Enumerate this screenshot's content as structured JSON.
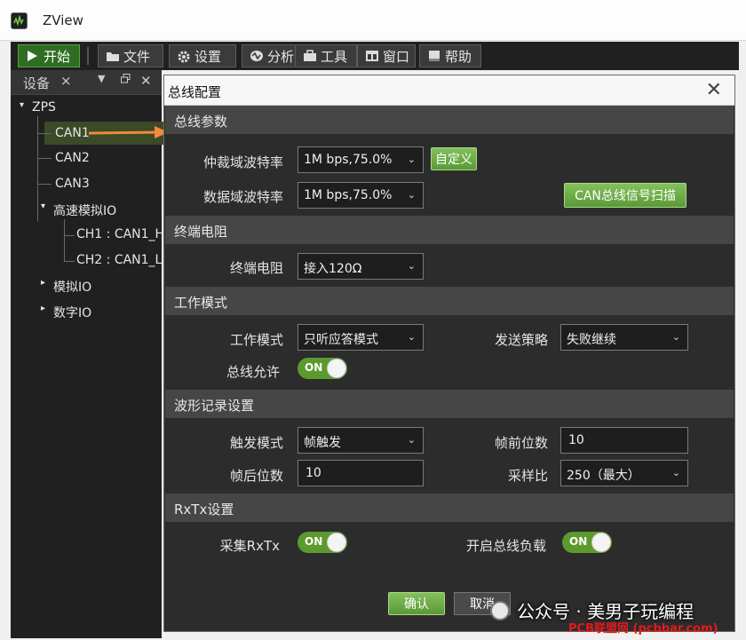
{
  "app": {
    "title": "ZView"
  },
  "menu": [
    {
      "label": "开始",
      "icon": "play-icon"
    },
    {
      "label": "文件",
      "icon": "folder-icon"
    },
    {
      "label": "设置",
      "icon": "gear-icon"
    },
    {
      "label": "分析",
      "icon": "analyze-icon"
    },
    {
      "label": "工具",
      "icon": "toolbox-icon"
    },
    {
      "label": "窗口",
      "icon": "window-icon"
    },
    {
      "label": "帮助",
      "icon": "help-icon"
    }
  ],
  "device_panel": {
    "title": "设备",
    "close": "×",
    "menu": "▼",
    "float": "🗗",
    "close2": "✕",
    "tree": {
      "root": "ZPS",
      "can1": "CAN1",
      "can2": "CAN2",
      "can3": "CAN3",
      "hs_analog": "高速模拟IO",
      "ch1": "CH1 : CAN1_H",
      "ch2": "CH2 : CAN1_L",
      "analog": "模拟IO",
      "digital": "数字IO"
    },
    "expand_open": "▾",
    "expand_closed": "▸"
  },
  "dialog": {
    "title": "总线配置",
    "close": "✕",
    "sections": {
      "bus_params": "总线参数",
      "termination": "终端电阻",
      "work_mode": "工作模式",
      "waveform": "波形记录设置",
      "rxtx": "RxTx设置"
    },
    "fields": {
      "arb_rate_label": "仲裁域波特率",
      "arb_rate_value": "1M bps,75.0%",
      "custom_button": "自定义",
      "data_rate_label": "数据域波特率",
      "data_rate_value": "1M bps,75.0%",
      "scan_button": "CAN总线信号扫描",
      "term_label": "终端电阻",
      "term_value": "接入120Ω",
      "mode_label": "工作模式",
      "mode_value": "只听应答模式",
      "send_policy_label": "发送策略",
      "send_policy_value": "失败继续",
      "bus_allow_label": "总线允许",
      "bus_allow_state": "ON",
      "trigger_mode_label": "触发模式",
      "trigger_mode_value": "帧触发",
      "pre_frames_label": "帧前位数",
      "pre_frames_value": "10",
      "post_frames_label": "帧后位数",
      "post_frames_value": "10",
      "sample_ratio_label": "采样比",
      "sample_ratio_value": "250（最大）",
      "collect_rxtx_label": "采集RxTx",
      "collect_rxtx_state": "ON",
      "bus_load_label": "开启总线负载",
      "bus_load_state": "ON"
    },
    "ok_button": "确认",
    "cancel_button": "取消"
  },
  "watermark": {
    "text": "公众号 · 美男子玩编程",
    "sub": "PCB联盟网 (pcbbar.com)"
  },
  "colors": {
    "accent_green": "#5d9a2e",
    "panel_bg": "#202020",
    "dialog_bg": "#2c2c2c",
    "section_bg": "#464646",
    "arrow": "#f08a3c"
  }
}
